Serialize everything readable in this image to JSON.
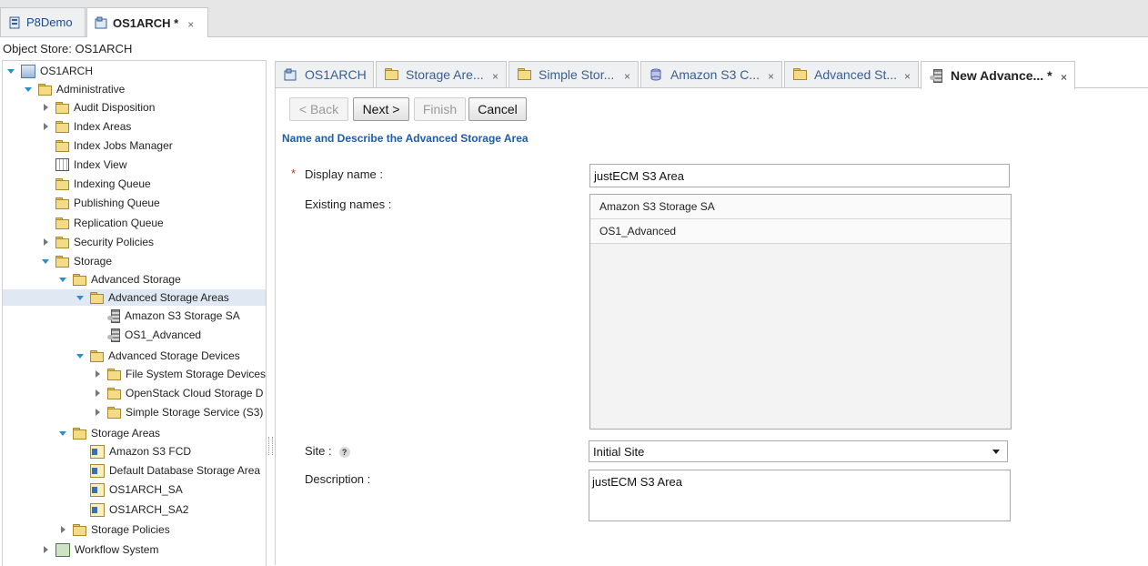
{
  "top_tabs": [
    {
      "label": "P8Demo",
      "icon": "object-store-icon"
    },
    {
      "label": "OS1ARCH *",
      "icon": "object-store-icon",
      "close": "×"
    }
  ],
  "object_store_label": "Object Store: OS1ARCH",
  "tree": {
    "root": "OS1ARCH",
    "administrative": "Administrative",
    "audit_disposition": "Audit Disposition",
    "index_areas": "Index Areas",
    "index_jobs_manager": "Index Jobs Manager",
    "index_view": "Index View",
    "indexing_queue": "Indexing Queue",
    "publishing_queue": "Publishing Queue",
    "replication_queue": "Replication Queue",
    "security_policies": "Security Policies",
    "storage": "Storage",
    "advanced_storage": "Advanced Storage",
    "advanced_storage_areas": "Advanced Storage Areas",
    "amazon_s3_storage_sa": "Amazon S3 Storage SA",
    "os1_advanced": "OS1_Advanced",
    "advanced_storage_devices": "Advanced Storage Devices",
    "file_system_storage_devices": "File System Storage Devices",
    "openstack_cloud_storage": "OpenStack Cloud Storage D",
    "simple_storage_service": "Simple Storage Service (S3)",
    "storage_areas": "Storage Areas",
    "amazon_s3_fcd": "Amazon S3 FCD",
    "default_database_storage_area": "Default Database Storage Area",
    "os1arch_sa": "OS1ARCH_SA",
    "os1arch_sa2": "OS1ARCH_SA2",
    "storage_policies": "Storage Policies",
    "workflow_system": "Workflow System"
  },
  "inner_tabs": [
    {
      "label": "OS1ARCH",
      "icon": "object-store-icon"
    },
    {
      "label": "Storage Are...",
      "icon": "folder-icon",
      "close": "×"
    },
    {
      "label": "Simple Stor...",
      "icon": "folder-icon",
      "close": "×"
    },
    {
      "label": "Amazon S3 C...",
      "icon": "storage-device-icon",
      "close": "×"
    },
    {
      "label": "Advanced St...",
      "icon": "folder-icon",
      "close": "×"
    },
    {
      "label": "New Advance... *",
      "icon": "server-icon",
      "close": "×"
    }
  ],
  "wizard": {
    "back": "< Back",
    "next": "Next >",
    "finish": "Finish",
    "cancel": "Cancel",
    "title": "Name and Describe the Advanced Storage Area",
    "required_marker": "*",
    "display_name_label": "Display name :",
    "display_name_value": "justECM S3 Area",
    "existing_names_label": "Existing names :",
    "existing_names": [
      "Amazon S3 Storage SA",
      "OS1_Advanced"
    ],
    "site_label": "Site :",
    "site_help": "?",
    "site_value": "Initial Site",
    "description_label": "Description :",
    "description_value": "justECM S3 Area"
  },
  "colors": {
    "accent_blue": "#1e5ca8",
    "tree_arrow": "#2a8fc7",
    "required_red": "#c8312a"
  }
}
